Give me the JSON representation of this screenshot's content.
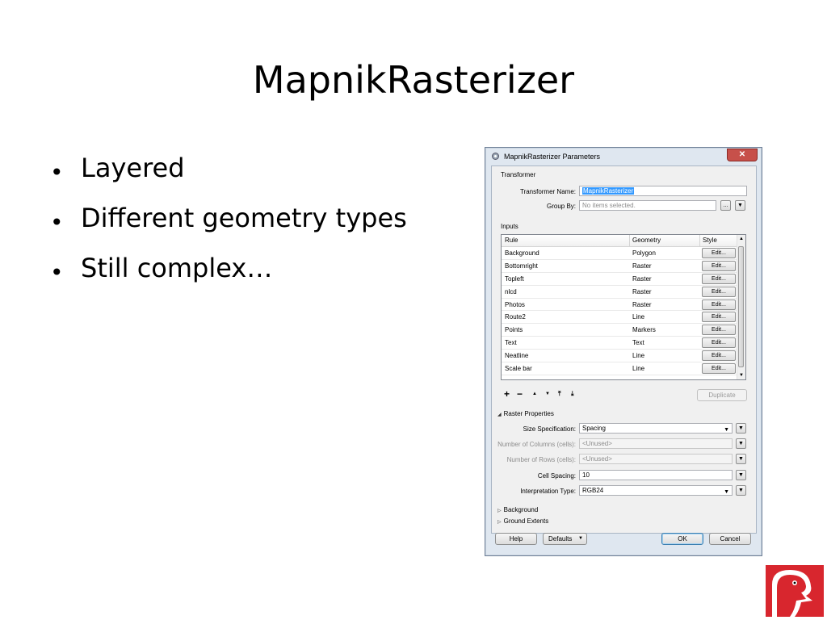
{
  "slide": {
    "title": "MapnikRasterizer",
    "bullets": [
      "Layered",
      "Different geometry types",
      "Still complex…"
    ]
  },
  "dialog": {
    "title": "MapnikRasterizer Parameters",
    "close_label": "✕",
    "transformer": {
      "group_label": "Transformer",
      "name_label": "Transformer Name:",
      "name_value": "MapnikRasterizer",
      "group_by_label": "Group By:",
      "group_by_placeholder": "No items selected.",
      "ellipsis_label": "...",
      "dropdown_glyph": "▼"
    },
    "inputs": {
      "group_label": "Inputs",
      "columns": [
        "Rule",
        "Geometry",
        "Style"
      ],
      "edit_label": "Edit...",
      "rows": [
        {
          "rule": "Background",
          "geometry": "Polygon"
        },
        {
          "rule": "Bottomright",
          "geometry": "Raster"
        },
        {
          "rule": "Topleft",
          "geometry": "Raster"
        },
        {
          "rule": "nlcd",
          "geometry": "Raster"
        },
        {
          "rule": "Photos",
          "geometry": "Raster"
        },
        {
          "rule": "Route2",
          "geometry": "Line"
        },
        {
          "rule": "Points",
          "geometry": "Markers"
        },
        {
          "rule": "Text",
          "geometry": "Text"
        },
        {
          "rule": "Neatline",
          "geometry": "Line"
        },
        {
          "rule": "Scale bar",
          "geometry": "Line"
        }
      ],
      "toolbar": {
        "add": "+",
        "remove": "−",
        "up": "▲",
        "down": "▼",
        "top": "⤒",
        "bottom": "⤓",
        "duplicate_label": "Duplicate"
      }
    },
    "raster_properties": {
      "section_label": "Raster Properties",
      "size_spec_label": "Size Specification:",
      "size_spec_value": "Spacing",
      "columns_label": "Number of Columns (cells):",
      "columns_value": "<Unused>",
      "rows_label": "Number of Rows (cells):",
      "rows_value": "<Unused>",
      "cell_spacing_label": "Cell Spacing:",
      "cell_spacing_value": "10",
      "interp_label": "Interpretation Type:",
      "interp_value": "RGB24"
    },
    "collapsed_sections": [
      "Background",
      "Ground Extents"
    ],
    "buttons": {
      "help": "Help",
      "defaults": "Defaults",
      "ok": "OK",
      "cancel": "Cancel"
    }
  },
  "colors": {
    "selection": "#3399ff",
    "close": "#c7504a",
    "logo_red": "#d8262e"
  }
}
